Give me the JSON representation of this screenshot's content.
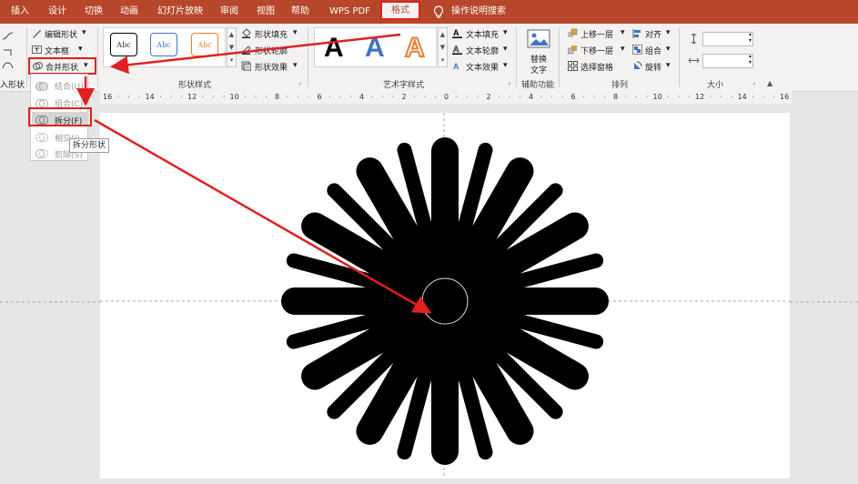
{
  "menubar": {
    "tabs": [
      "插入",
      "设计",
      "切换",
      "动画",
      "幻灯片放映",
      "审阅",
      "视图",
      "帮助",
      "WPS PDF"
    ],
    "active_tab": "格式",
    "search_label": "操作说明搜索"
  },
  "ribbon": {
    "insert_shapes_label": "入形状",
    "edit_shape": "编辑形状",
    "text_box": "文本框",
    "merge_shapes": "合并形状",
    "shape_styles": {
      "label": "形状样式",
      "preset_text": "Abc",
      "fill": "形状填充",
      "outline": "形状轮廓",
      "effects": "形状效果"
    },
    "wordart": {
      "label": "艺术字样式",
      "letter": "A",
      "text_fill": "文本填充",
      "text_outline": "文本轮廓",
      "text_effects": "文本效果"
    },
    "accessibility": {
      "label": "辅助功能",
      "alt_text_line1": "替换",
      "alt_text_line2": "文字"
    },
    "arrange": {
      "label": "排列",
      "bring_forward": "上移一层",
      "send_backward": "下移一层",
      "selection_pane": "选择窗格",
      "align": "对齐",
      "group": "组合",
      "rotate": "旋转"
    },
    "size": {
      "label": "大小",
      "height_value": "",
      "width_value": ""
    }
  },
  "merge_menu": {
    "items": [
      {
        "label": "结合(U)",
        "enabled": false
      },
      {
        "label": "组合(C)",
        "enabled": false
      },
      {
        "label": "拆分(F)",
        "enabled": true,
        "highlighted": true
      },
      {
        "label": "相交(I)",
        "enabled": false
      },
      {
        "label": "剪除(S)",
        "enabled": false
      }
    ],
    "tooltip": "拆分形状"
  },
  "ruler": {
    "labels": [
      "16",
      "14",
      "12",
      "10",
      "8",
      "6",
      "4",
      "2",
      "0",
      "2",
      "4",
      "6",
      "8",
      "10",
      "12",
      "14",
      "16"
    ]
  },
  "colors": {
    "brand": "#b7472a",
    "annotation": "#e02020",
    "shape_fill": "#000000"
  }
}
